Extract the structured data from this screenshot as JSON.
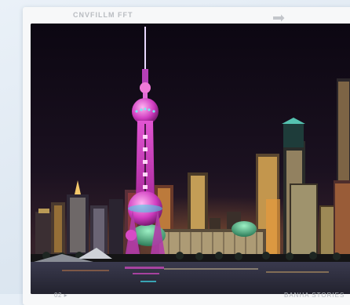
{
  "header": {
    "brand": "CNVFILLM FFT",
    "share_icon": "arrow-right-icon"
  },
  "photo": {
    "subject": "city-skyline-night"
  },
  "footer": {
    "left_text": "02 ▸",
    "right_text": "BANHA STORIES"
  },
  "colors": {
    "card": "#f7f8f9",
    "brand_text": "#b9bcc1",
    "tower_magenta": "#d83ac9",
    "tower_cyan": "#3fd8e6",
    "sky": "#120b1a"
  }
}
